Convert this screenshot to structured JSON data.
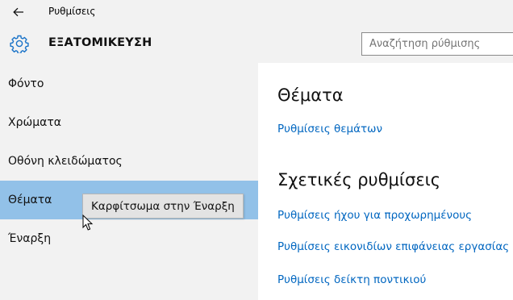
{
  "window": {
    "title": "Ρυθμίσεις"
  },
  "header": {
    "section_title": "ΕΞΑΤΟΜΙΚΕΥΣΗ",
    "search_placeholder": "Αναζήτηση ρύθμισης"
  },
  "sidebar": {
    "items": [
      {
        "label": "Φόντο",
        "selected": false
      },
      {
        "label": "Χρώματα",
        "selected": false
      },
      {
        "label": "Οθόνη κλειδώματος",
        "selected": false
      },
      {
        "label": "Θέματα",
        "selected": true
      },
      {
        "label": "Έναρξη",
        "selected": false
      }
    ],
    "selected_color": "#92c1e8"
  },
  "tooltip": {
    "text": "Καρφίτσωμα στην Έναρξη"
  },
  "main": {
    "themes_heading": "Θέματα",
    "themes_link": "Ρυθμίσεις θεμάτων",
    "related_heading": "Σχετικές ρυθμίσεις",
    "related_links": [
      "Ρυθμίσεις ήχου για προχωρημένους",
      "Ρυθμίσεις εικονιδίων επιφάνειας εργασίας",
      "Ρυθμίσεις δείκτη ποντικιού"
    ],
    "link_color": "#0066c0"
  },
  "icons": [
    "back-arrow-icon",
    "gear-icon",
    "mouse-cursor-icon"
  ]
}
